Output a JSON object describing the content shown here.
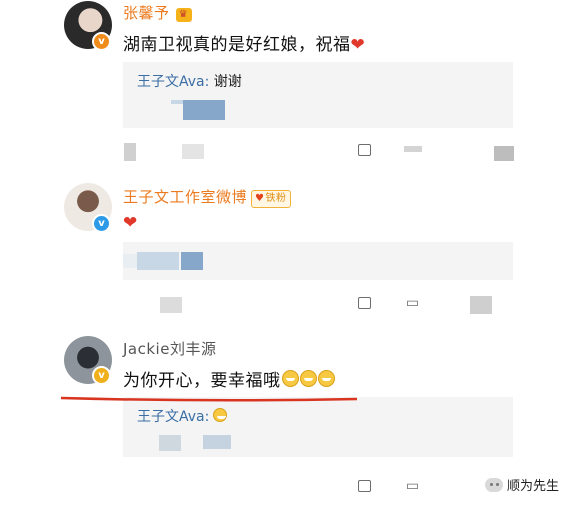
{
  "comments": [
    {
      "username": "张馨予",
      "text": "湖南卫视真的是好红娘，祝福",
      "reply_name": "王子文Ava:",
      "reply_text": " 谢谢",
      "verify_badge": "v"
    },
    {
      "username": "王子文工作室微博",
      "fans_badge_icon": "♥",
      "fans_badge": "铁粉",
      "verify_badge": "v"
    },
    {
      "username": "Jackie刘丰源",
      "text": "为你开心，要幸福哦",
      "reply_name": "王子文Ava:",
      "verify_badge": "v"
    }
  ],
  "watermark": "顺为先生",
  "colors": {
    "username_orange": "#ec7b1f",
    "reply_blue": "#3a6ea5",
    "verified_orange": "#f08c1c",
    "verified_blue": "#2d9ae8",
    "underline_red": "#d9341f"
  },
  "icons": [
    "crown-icon",
    "heart-icon",
    "share-icon",
    "comment-icon",
    "smile-emoji-icon",
    "wechat-icon"
  ]
}
